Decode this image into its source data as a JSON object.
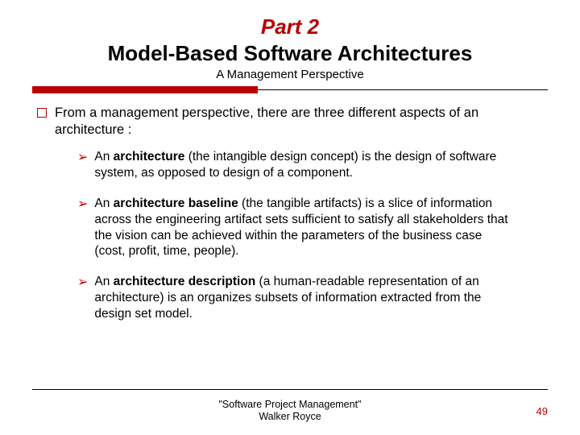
{
  "header": {
    "part": "Part 2",
    "title": "Model-Based Software Architectures",
    "subtitle": "A Management Perspective"
  },
  "intro": "From a management perspective, there are three different aspects of an architecture :",
  "items": [
    {
      "lead": "An ",
      "bold": "architecture",
      "rest": " (the intangible design concept) is the design of software system, as opposed to design of a component."
    },
    {
      "lead": "An ",
      "bold": "architecture baseline",
      "rest": " (the tangible artifacts) is a slice of information across the engineering artifact sets sufficient to satisfy all stakeholders that the vision can be achieved within the parameters of the business case (cost, profit, time, people)."
    },
    {
      "lead": "An ",
      "bold": "architecture description",
      "rest": " (a human-readable representation of an architecture) is an organizes subsets of information extracted from the design set model."
    }
  ],
  "footer": {
    "cite1": "\"Software Project Management\"",
    "cite2": "Walker Royce",
    "page": "49"
  }
}
